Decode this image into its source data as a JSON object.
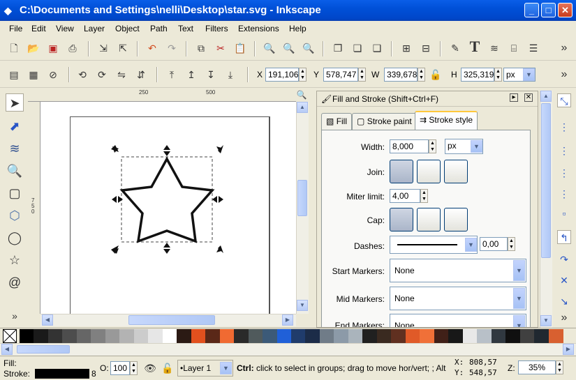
{
  "window": {
    "title": "C:\\Documents and Settings\\nelli\\Desktop\\star.svg - Inkscape",
    "controls": {
      "minimize": "_",
      "maximize": "□",
      "close": "✕"
    }
  },
  "menu": [
    "File",
    "Edit",
    "View",
    "Layer",
    "Object",
    "Path",
    "Text",
    "Filters",
    "Extensions",
    "Help"
  ],
  "toolbar_overflow": "»",
  "select_toolbar": {
    "x_label": "X",
    "x_value": "191,106",
    "y_label": "Y",
    "y_value": "578,747",
    "w_label": "W",
    "w_value": "339,678",
    "h_label": "H",
    "h_value": "325,319",
    "units": "px"
  },
  "ruler": {
    "h_ticks": [
      "250",
      "500"
    ],
    "v_ticks": [
      "750"
    ]
  },
  "dialog": {
    "title": "Fill and Stroke (Shift+Ctrl+F)",
    "tabs": [
      "Fill",
      "Stroke paint",
      "Stroke style"
    ],
    "active_tab": "Stroke style",
    "width_label": "Width:",
    "width_value": "8,000",
    "width_units": "px",
    "join_label": "Join:",
    "miter_label": "Miter limit:",
    "miter_value": "4,00",
    "cap_label": "Cap:",
    "dashes_label": "Dashes:",
    "dashes_offset": "0,00",
    "start_markers_label": "Start Markers:",
    "start_markers_value": "None",
    "mid_markers_label": "Mid Markers:",
    "mid_markers_value": "None",
    "end_markers_label": "End Markers:",
    "end_markers_value": "None"
  },
  "palette_colors": [
    "#000000",
    "#1a1a1a",
    "#333333",
    "#4d4d4d",
    "#666666",
    "#808080",
    "#999999",
    "#b3b3b3",
    "#cccccc",
    "#e6e6e6",
    "#ffffff",
    "#2b1a14",
    "#e2501e",
    "#5a2818",
    "#f06a32",
    "#2a2a2a",
    "#505a5c",
    "#3c5a78",
    "#2060d8",
    "#203c6c",
    "#1c2c48",
    "#707c88",
    "#8c9aa8",
    "#aab4bc",
    "#202020",
    "#3a2a20",
    "#603020",
    "#e05a28",
    "#f07038",
    "#402018",
    "#181818",
    "#e8e8e8",
    "#b8c0c8",
    "#303840",
    "#101010",
    "#404040",
    "#202830",
    "#d86030"
  ],
  "status": {
    "fill_label": "Fill:",
    "stroke_label": "Stroke:",
    "stroke_width": "8",
    "opacity_label": "O:",
    "opacity_value": "100",
    "layer": "•Layer 1",
    "message_bold": "Ctrl:",
    "message": " click to select in groups; drag to move hor/vert; ; Alt",
    "x_label": "X:",
    "x_value": "808,57",
    "y_label": "Y:",
    "y_value": "548,57",
    "zoom_label": "Z:",
    "zoom_value": "35%"
  }
}
